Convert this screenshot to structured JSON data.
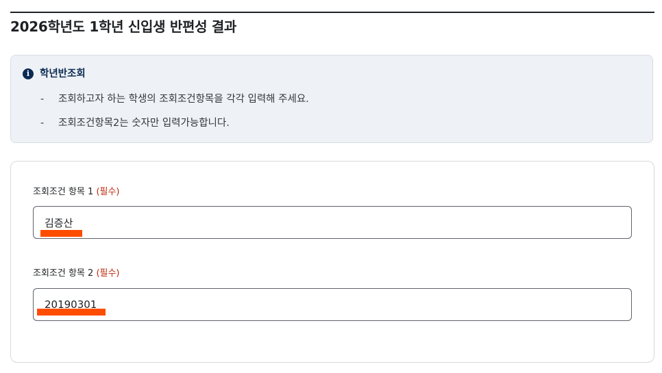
{
  "page": {
    "title": "2026학년도 1학년 신입생 반편성 결과"
  },
  "notice": {
    "icon": "info-icon",
    "icon_glyph": "i",
    "title": "학년반조회",
    "items": [
      "조회하고자 하는 학생의 조회조건항목을 각각 입력해 주세요.",
      "조회조건항목2는 숫자만 입력가능합니다."
    ],
    "dash": "-"
  },
  "form": {
    "field1": {
      "label": "조회조건 항목 1",
      "required": "(필수)",
      "value": "김증산"
    },
    "field2": {
      "label": "조회조건 항목 2",
      "required": "(필수)",
      "value": "20190301"
    }
  },
  "colors": {
    "required_text": "#bd2c0f",
    "redaction_mark": "#ff4d00",
    "notice_icon": "#0b2b52",
    "notice_background": "#eef1f5"
  }
}
